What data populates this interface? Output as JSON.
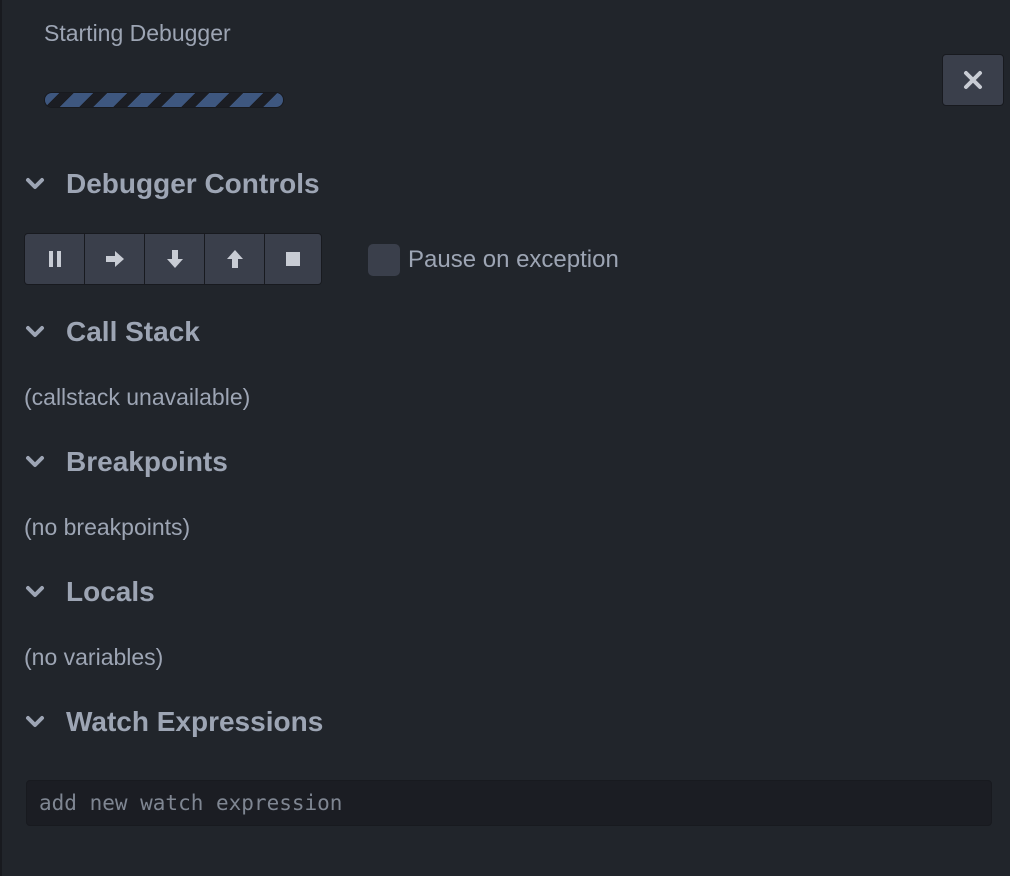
{
  "header": {
    "title": "Starting Debugger",
    "progress": 1.0
  },
  "close_icon": "close-icon",
  "sections": {
    "controls": {
      "title": "Debugger Controls"
    },
    "callstack": {
      "title": "Call Stack",
      "empty": "(callstack unavailable)"
    },
    "breakpoints": {
      "title": "Breakpoints",
      "empty": "(no breakpoints)"
    },
    "locals": {
      "title": "Locals",
      "empty": "(no variables)"
    },
    "watch": {
      "title": "Watch Expressions",
      "placeholder": "add new watch expression"
    }
  },
  "controls": {
    "buttons": [
      "pause-icon",
      "step-over-icon",
      "step-into-icon",
      "step-out-icon",
      "stop-icon"
    ],
    "pause_on_exception_label": "Pause on exception",
    "pause_on_exception_checked": false
  },
  "colors": {
    "background": "#21252b",
    "button": "#3a3f4b",
    "text": "#9da5b4",
    "progress_stripe": "#3e577f"
  }
}
